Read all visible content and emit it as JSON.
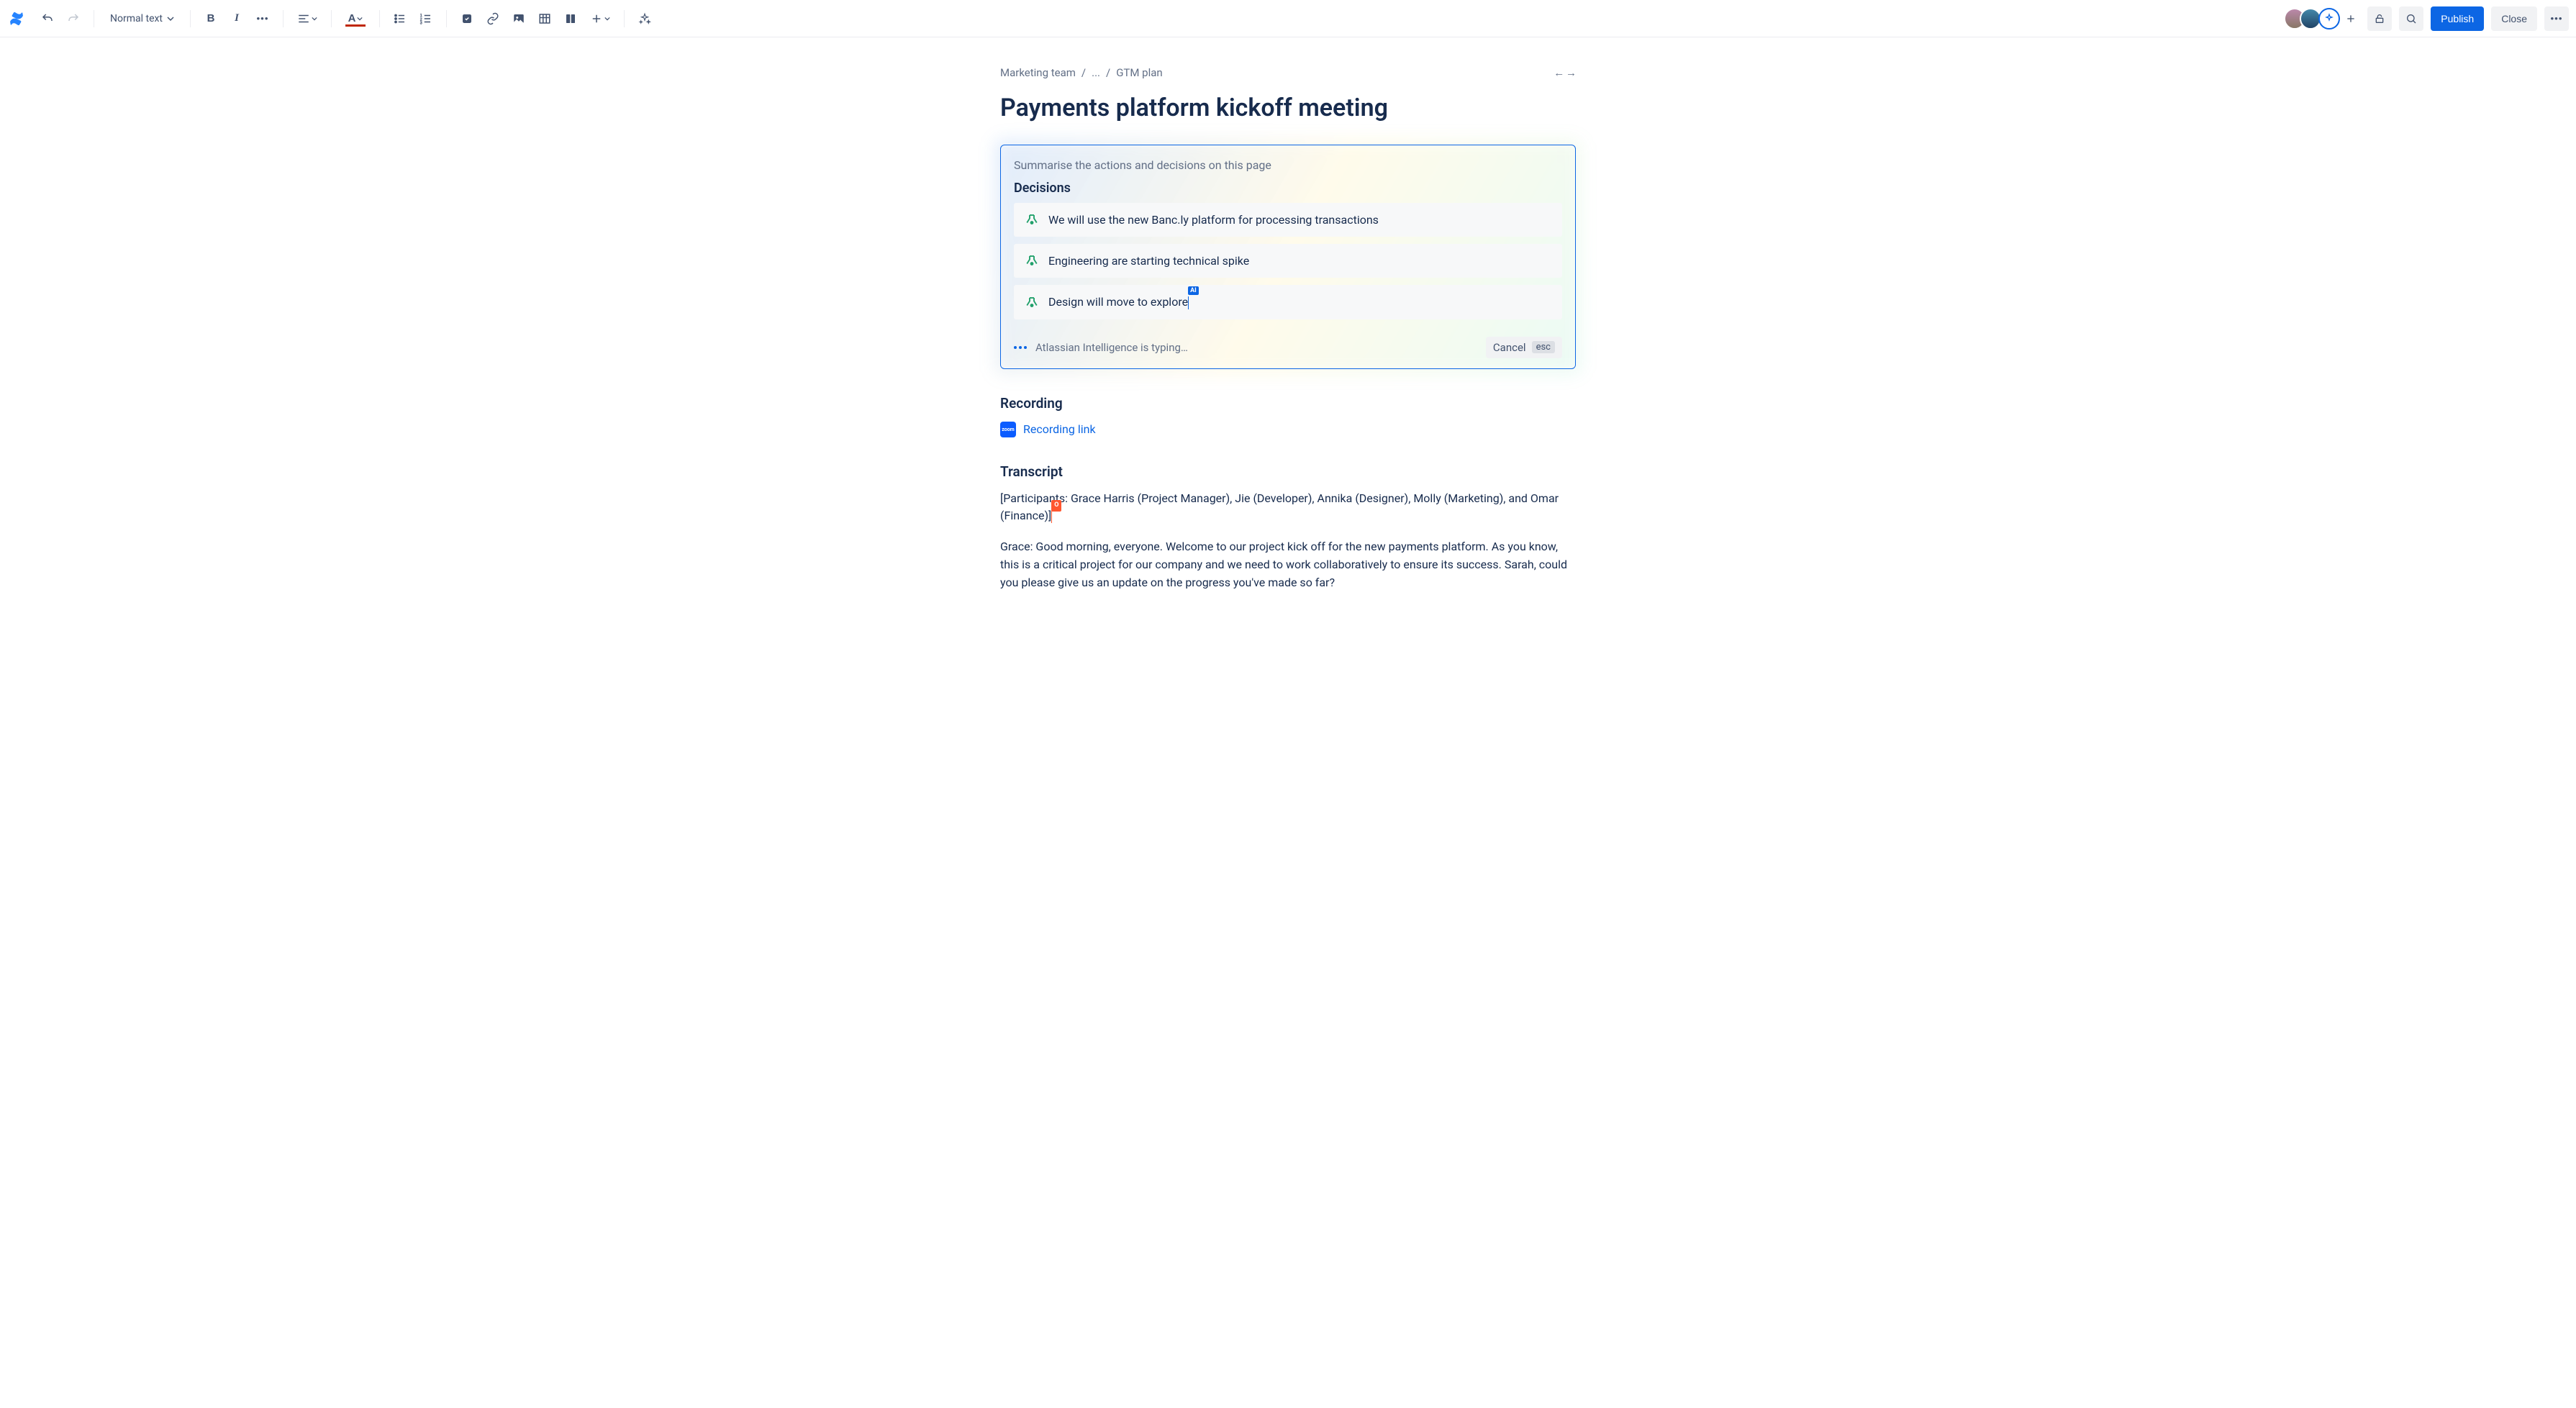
{
  "toolbar": {
    "text_style": "Normal text",
    "publish": "Publish",
    "close": "Close"
  },
  "breadcrumbs": {
    "items": [
      "Marketing team",
      "...",
      "GTM plan"
    ]
  },
  "page": {
    "title": "Payments platform kickoff meeting"
  },
  "ai": {
    "prompt": "Summarise the actions and decisions on this page",
    "section_title": "Decisions",
    "decisions": [
      "We will use the new Banc.ly platform for processing transactions",
      "Engineering are starting technical spike",
      "Design will move to explore"
    ],
    "cursor_flag": "AI",
    "typing_label": "Atlassian Intelligence is typing…",
    "cancel": "Cancel",
    "esc": "esc"
  },
  "recording": {
    "heading": "Recording",
    "badge": "zoom",
    "link": "Recording link"
  },
  "transcript": {
    "heading": "Transcript",
    "participants": "[Participants: Grace Harris (Project Manager), Jie (Developer),  Annika (Designer), Molly (Marketing), and  Omar (Finance)]",
    "user_flag": "O",
    "p1": "Grace: Good morning, everyone. Welcome to our project kick off for the new payments platform. As you know, this is a critical project for our company and we need to work collaboratively to ensure its success. Sarah, could you please give us an update on the progress you've made so far?"
  }
}
